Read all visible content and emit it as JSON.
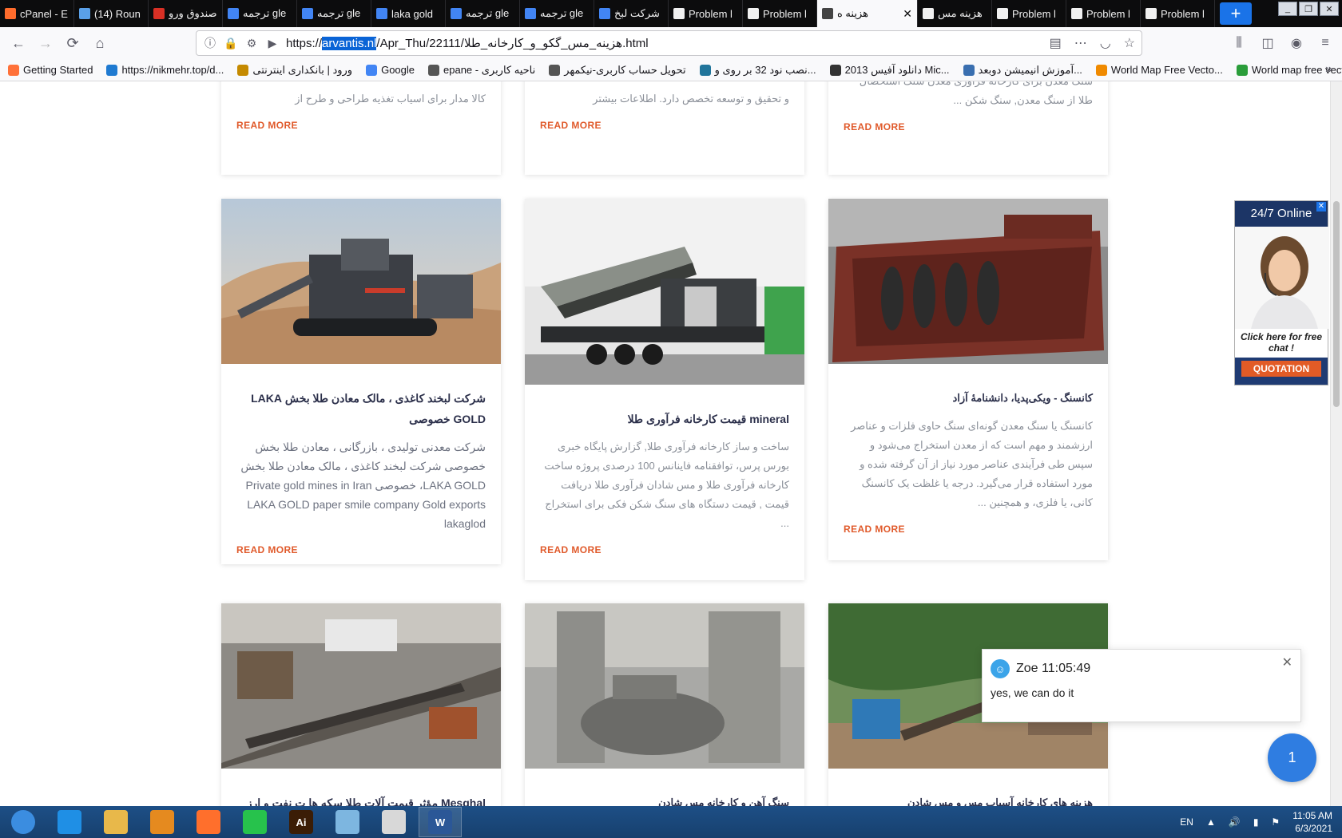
{
  "browser": {
    "tabs": [
      {
        "label": "cPanel - E",
        "icon": "cpanel-icon",
        "color": "#ff6c2c"
      },
      {
        "label": "(14) Roun",
        "icon": "globe-icon",
        "color": "#5aa0e8"
      },
      {
        "label": "صندوق ورو",
        "icon": "gmail-icon",
        "color": "#d93025"
      },
      {
        "label": "ترجمه gle",
        "icon": "translate-icon",
        "color": "#4285f4"
      },
      {
        "label": "ترجمه gle",
        "icon": "translate-icon",
        "color": "#4285f4"
      },
      {
        "label": "laka gold",
        "icon": "google-icon",
        "color": "#4285f4"
      },
      {
        "label": "ترجمه gle",
        "icon": "translate-icon",
        "color": "#4285f4"
      },
      {
        "label": "ترجمه gle",
        "icon": "translate-icon",
        "color": "#4285f4"
      },
      {
        "label": "شرکت لبخ",
        "icon": "google-icon",
        "color": "#4285f4"
      },
      {
        "label": "Problem l",
        "icon": "warning-icon",
        "color": "#f1f1f1"
      },
      {
        "label": "Problem l",
        "icon": "warning-icon",
        "color": "#f1f1f1"
      },
      {
        "label": "هزینه ه",
        "icon": "speaker-icon",
        "color": "#444",
        "active": true
      },
      {
        "label": "هزینه مس",
        "icon": "play-icon",
        "color": "#f1f1f1"
      },
      {
        "label": "Problem l",
        "icon": "warning-icon",
        "color": "#f1f1f1"
      },
      {
        "label": "Problem l",
        "icon": "warning-icon",
        "color": "#f1f1f1"
      },
      {
        "label": "Problem l",
        "icon": "warning-icon",
        "color": "#f1f1f1"
      }
    ],
    "url_prefix": "https://",
    "url_selected": "arvantis.nl",
    "url_rest": "/Apr_Thu/22111/هزینه_مس_گکو_و_کارخانه_طلا.html",
    "bookmarks": [
      {
        "label": "Getting Started",
        "color": "#ff7139"
      },
      {
        "label": "https://nikmehr.top/d...",
        "color": "#1f7ad1"
      },
      {
        "label": "ورود | بانکداری اینترنتی",
        "color": "#c58a00"
      },
      {
        "label": "Google",
        "color": "#4285f4"
      },
      {
        "label": "epane - ناحیه کاربری",
        "color": "#555"
      },
      {
        "label": "تحویل حساب کاربری-نیکمهر",
        "color": "#555"
      },
      {
        "label": "نصب نود 32 بر روی و...",
        "color": "#21759b"
      },
      {
        "label": "دانلود آفیس 2013 Mic...",
        "color": "#333"
      },
      {
        "label": "آموزش انیمیشن دوبعد...",
        "color": "#3a6fb0"
      },
      {
        "label": "World Map Free Vecto...",
        "color": "#f08a00"
      },
      {
        "label": "World map free vector...",
        "color": "#2a9d3a"
      }
    ]
  },
  "page": {
    "cards_top": [
      {
        "desc": "کالا مدار برای اسیاب تغذیه طراحی و طرح از",
        "more": "READ MORE"
      },
      {
        "desc": "و تحقیق و توسعه تخصص دارد. اطلاعات بیشتر",
        "more": "READ MORE"
      },
      {
        "desc": "سنگ معدن برای کارخانه فراوری معدن سنگ استحصال طلا از سنگ معدن, سنگ شکن ...",
        "more": "READ MORE"
      }
    ],
    "cards_mid": [
      {
        "title": "شرکت لبخند کاغذی ، مالک معادن طلا بخش LAKA GOLD خصوصی",
        "desc": "شرکت معدنی تولیدی ، بازرگانی ، معادن طلا بخش خصوصی شرکت لبخند کاغذی ، مالک معادن طلا بخش LAKA GOLD، خصوصی Private gold mines in Iran LAKA GOLD paper smile company Gold exports lakaglod",
        "more": "READ MORE"
      },
      {
        "title": "mineral قیمت کارخانه فرآوری طلا",
        "desc": "ساخت و ساز کارخانه فرآوری طلا, گزارش پایگاه خبری بورس پرس، توافقنامه فاینانس 100 درصدی پروژه ساخت کارخانه فرآوری طلا و مس شادان فرآوری طلا دریافت قیمت , قیمت دستگاه های سنگ شکن فکی برای استخراج ...",
        "more": "READ MORE"
      },
      {
        "title": "کانسنگ - ویکی‌پدیا، دانشنامهٔ آزاد",
        "desc": "کانسنگ یا سنگ معدن گونه‌ای سنگ حاوی فلزات و عناصر ارزشمند و مهم است که از معدن استخراج می‌شود و سپس طی فرآیندی عناصر مورد نیاز از آن گرفته شده و مورد استفاده قرار می‌گیرد. درجه یا غلظت یک کانسنگ کانی، یا فلزی، و همچنین ...",
        "more": "READ MORE"
      }
    ],
    "cards_bottom": [
      {
        "title": "Mesghal مؤثر قیمت آلات طلا سکه ها ت نفت و ارز"
      },
      {
        "title": "سنگ آهن و کارخانه مس شادن"
      },
      {
        "title": "هزینه های کارخانه آسیاب مس و مس شادن"
      }
    ]
  },
  "widgets": {
    "online_title": "24/7 Online",
    "online_text": "Click here for free chat !",
    "quotation": "QUOTATION",
    "chat_name": "Zoe 11:05:49",
    "chat_msg": "yes,  we can do it",
    "bubble_count": "1"
  },
  "taskbar": {
    "lang": "EN",
    "time": "11:05 AM",
    "date": "6/3/2021",
    "apps": [
      {
        "name": "start-orb",
        "color": "#3b8de0"
      },
      {
        "name": "ie-icon",
        "color": "#1f8fe5"
      },
      {
        "name": "explorer-icon",
        "color": "#e8b84a"
      },
      {
        "name": "media-player-icon",
        "color": "#e58a1f"
      },
      {
        "name": "firefox-icon",
        "color": "#ff6f2c"
      },
      {
        "name": "whatsapp-icon",
        "color": "#27c24c"
      },
      {
        "name": "illustrator-icon",
        "color": "#3b1d06",
        "text": "Ai"
      },
      {
        "name": "notepad-icon",
        "color": "#7db6e0"
      },
      {
        "name": "cyberghost-icon",
        "color": "#d8d8d8"
      },
      {
        "name": "word-icon",
        "color": "#2b5797",
        "text": "W"
      }
    ]
  }
}
